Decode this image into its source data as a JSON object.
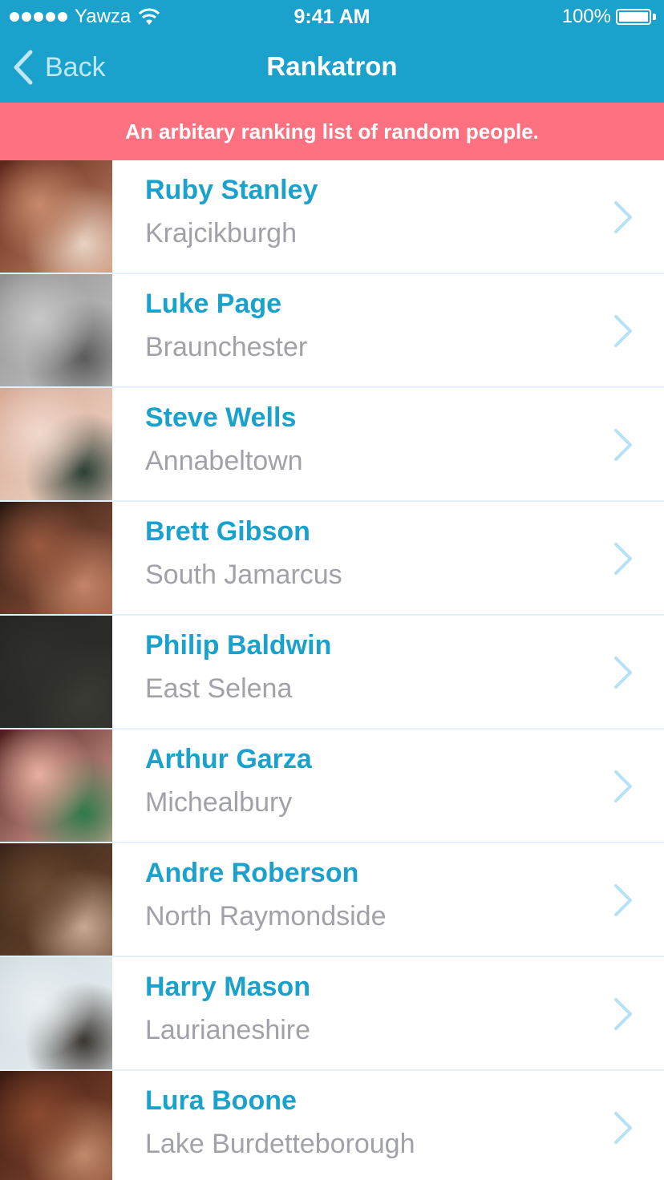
{
  "status": {
    "carrier": "Yawza",
    "time": "9:41 AM",
    "battery": "100%"
  },
  "nav": {
    "back_label": "Back",
    "title": "Rankatron"
  },
  "banner": {
    "text": "An arbitary ranking list of random people."
  },
  "colors": {
    "header": "#1aa1cc",
    "banner": "#fd7180",
    "name": "#1aa1cc",
    "city": "#a1a1a9",
    "chevron": "#b5e0f5"
  },
  "people": [
    {
      "name": "Ruby Stanley",
      "city": "Krajcikburgh",
      "photo": [
        "#5a2418",
        "#c88a6a",
        "#e8d2c2"
      ]
    },
    {
      "name": "Luke Page",
      "city": "Braunchester",
      "photo": [
        "#8f8f8f",
        "#c7c7c7",
        "#5b5b5b"
      ]
    },
    {
      "name": "Steve Wells",
      "city": "Annabeltown",
      "photo": [
        "#d7a892",
        "#f0d8cc",
        "#2d3f35"
      ]
    },
    {
      "name": "Brett Gibson",
      "city": "South Jamarcus",
      "photo": [
        "#2a1810",
        "#9a5a40",
        "#c48468"
      ]
    },
    {
      "name": "Philip Baldwin",
      "city": "East Selena",
      "photo": [
        "#252522",
        "#2f2f2b",
        "#3a3a35"
      ]
    },
    {
      "name": "Arthur Garza",
      "city": "Michealbury",
      "photo": [
        "#4a1b1b",
        "#e8b0a0",
        "#2f7a4a"
      ]
    },
    {
      "name": "Andre Roberson",
      "city": "North Raymondside",
      "photo": [
        "#3a2418",
        "#6b4a30",
        "#c8a890"
      ]
    },
    {
      "name": "Harry Mason",
      "city": "Laurianeshire",
      "photo": [
        "#d2dde2",
        "#e8eef1",
        "#3a3530"
      ]
    },
    {
      "name": "Lura Boone",
      "city": "Lake Burdetteborough",
      "photo": [
        "#3a1a10",
        "#8a4a30",
        "#c08a6a"
      ]
    }
  ]
}
